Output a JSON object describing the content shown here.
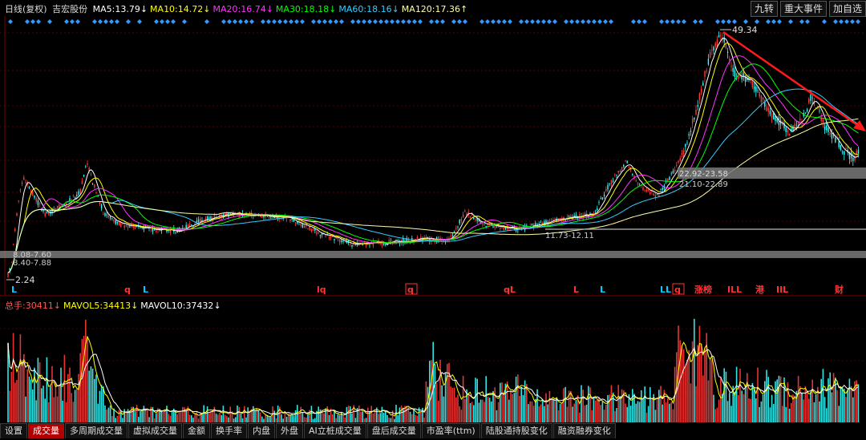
{
  "header": {
    "chart_type": "日线(复权)",
    "stock_name": "吉宏股份",
    "ma": [
      {
        "label": "MA5:",
        "value": "13.79",
        "arrow": "↓",
        "color": "#ffffff"
      },
      {
        "label": "MA10:",
        "value": "14.72",
        "arrow": "↓",
        "color": "#ffff00"
      },
      {
        "label": "MA20:",
        "value": "16.74",
        "arrow": "↓",
        "color": "#ff33ff"
      },
      {
        "label": "MA30:",
        "value": "18.18",
        "arrow": "↓",
        "color": "#00ff00"
      },
      {
        "label": "MA60:",
        "value": "18.16",
        "arrow": "↓",
        "color": "#33ccff"
      },
      {
        "label": "MA120:",
        "value": "17.36",
        "arrow": "↑",
        "color": "#ffffaa"
      }
    ],
    "buttons": [
      "九转",
      "重大事件",
      "加自选"
    ]
  },
  "price_labels": {
    "high": "49.34",
    "low": "2.24",
    "range_1": "22.92-23.58",
    "range_2": "21.10-22.89",
    "range_3": "11.73-12.11",
    "range_4": "8.08-7.60",
    "range_5": "8.40-7.88"
  },
  "markers": [
    {
      "text": "L",
      "color": "#00ccff"
    },
    {
      "text": "q",
      "color": "#ff3333"
    },
    {
      "text": "L",
      "color": "#00ccff"
    },
    {
      "text": "lq",
      "color": "#ff3333"
    },
    {
      "text": "q",
      "color": "#ff3333"
    },
    {
      "text": "qL",
      "color": "#ff3333"
    },
    {
      "text": "L",
      "color": "#ff3333"
    },
    {
      "text": "L",
      "color": "#00ccff"
    },
    {
      "text": "LL",
      "color": "#00ccff"
    },
    {
      "text": "q",
      "color": "#ff3333"
    },
    {
      "text": "涨榜",
      "color": "#ff3333"
    },
    {
      "text": "ILL",
      "color": "#ff3333"
    },
    {
      "text": "港",
      "color": "#ff3333"
    },
    {
      "text": "IIL",
      "color": "#ff3333"
    },
    {
      "text": "财",
      "color": "#ff3333"
    }
  ],
  "volume": {
    "items": [
      {
        "label": "总手:",
        "value": "30411",
        "arrow": "↓",
        "color": "#ff5555"
      },
      {
        "label": "MAVOL5:",
        "value": "34413",
        "arrow": "↓",
        "color": "#ffff00"
      },
      {
        "label": "MAVOL10:",
        "value": "37432",
        "arrow": "↓",
        "color": "#ffffff"
      }
    ]
  },
  "tabs": [
    "设置",
    "成交量",
    "多周期成交量",
    "虚拟成交量",
    "金额",
    "换手率",
    "内盘",
    "外盘",
    "AI立桩成交量",
    "盘后成交量",
    "市盈率(ttm)",
    "陆股通持股变化",
    "融资融券变化"
  ],
  "active_tab": 1
}
